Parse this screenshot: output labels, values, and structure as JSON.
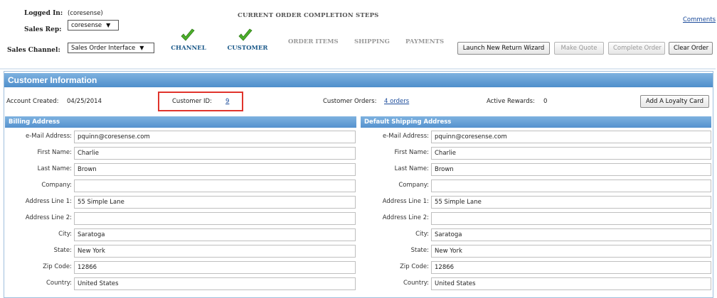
{
  "header": {
    "logged_in_label": "Logged In:",
    "logged_in_value": "(coresense)",
    "sales_rep_label": "Sales Rep:",
    "sales_rep_value": "coresense",
    "sales_channel_label": "Sales Channel:",
    "sales_channel_value": "Sales Order Interface",
    "comments_link": "Comments"
  },
  "steps": {
    "title": "CURRENT ORDER COMPLETION STEPS",
    "items": [
      {
        "label": "CHANNEL",
        "done": true
      },
      {
        "label": "CUSTOMER",
        "done": true
      },
      {
        "label": "ORDER ITEMS",
        "done": false
      },
      {
        "label": "SHIPPING",
        "done": false
      },
      {
        "label": "PAYMENTS",
        "done": false
      }
    ]
  },
  "toolbar": {
    "return_wizard": "Launch New Return Wizard",
    "make_quote": "Make Quote",
    "complete_order": "Complete Order",
    "clear_order": "Clear Order"
  },
  "customer_info": {
    "title": "Customer Information",
    "account_created_label": "Account Created:",
    "account_created_value": "04/25/2014",
    "customer_id_label": "Customer ID:",
    "customer_id_value": "9",
    "customer_orders_label": "Customer Orders:",
    "customer_orders_value": "4 orders",
    "active_rewards_label": "Active Rewards:",
    "active_rewards_value": "0",
    "loyalty_button": "Add A Loyalty Card"
  },
  "billing": {
    "title": "Billing Address",
    "fields": [
      {
        "label": "e-Mail Address:",
        "value": "pquinn@coresense.com"
      },
      {
        "label": "First Name:",
        "value": "Charlie"
      },
      {
        "label": "Last Name:",
        "value": "Brown"
      },
      {
        "label": "Company:",
        "value": ""
      },
      {
        "label": "Address Line 1:",
        "value": "55 Simple Lane"
      },
      {
        "label": "Address Line 2:",
        "value": ""
      },
      {
        "label": "City:",
        "value": "Saratoga"
      },
      {
        "label": "State:",
        "value": "New York"
      },
      {
        "label": "Zip Code:",
        "value": "12866"
      },
      {
        "label": "Country:",
        "value": "United States"
      }
    ]
  },
  "shipping": {
    "title": "Default Shipping Address",
    "fields": [
      {
        "label": "e-Mail Address:",
        "value": "pquinn@coresense.com"
      },
      {
        "label": "First Name:",
        "value": "Charlie"
      },
      {
        "label": "Last Name:",
        "value": "Brown"
      },
      {
        "label": "Company:",
        "value": ""
      },
      {
        "label": "Address Line 1:",
        "value": "55 Simple Lane"
      },
      {
        "label": "Address Line 2:",
        "value": ""
      },
      {
        "label": "City:",
        "value": "Saratoga"
      },
      {
        "label": "State:",
        "value": "New York"
      },
      {
        "label": "Zip Code:",
        "value": "12866"
      },
      {
        "label": "Country:",
        "value": "United States"
      }
    ]
  },
  "colors": {
    "header_blue": "#4f8fcc",
    "step_done": "#1c5a8a",
    "check_green": "#4caf2a",
    "highlight_red": "#e0342c"
  }
}
